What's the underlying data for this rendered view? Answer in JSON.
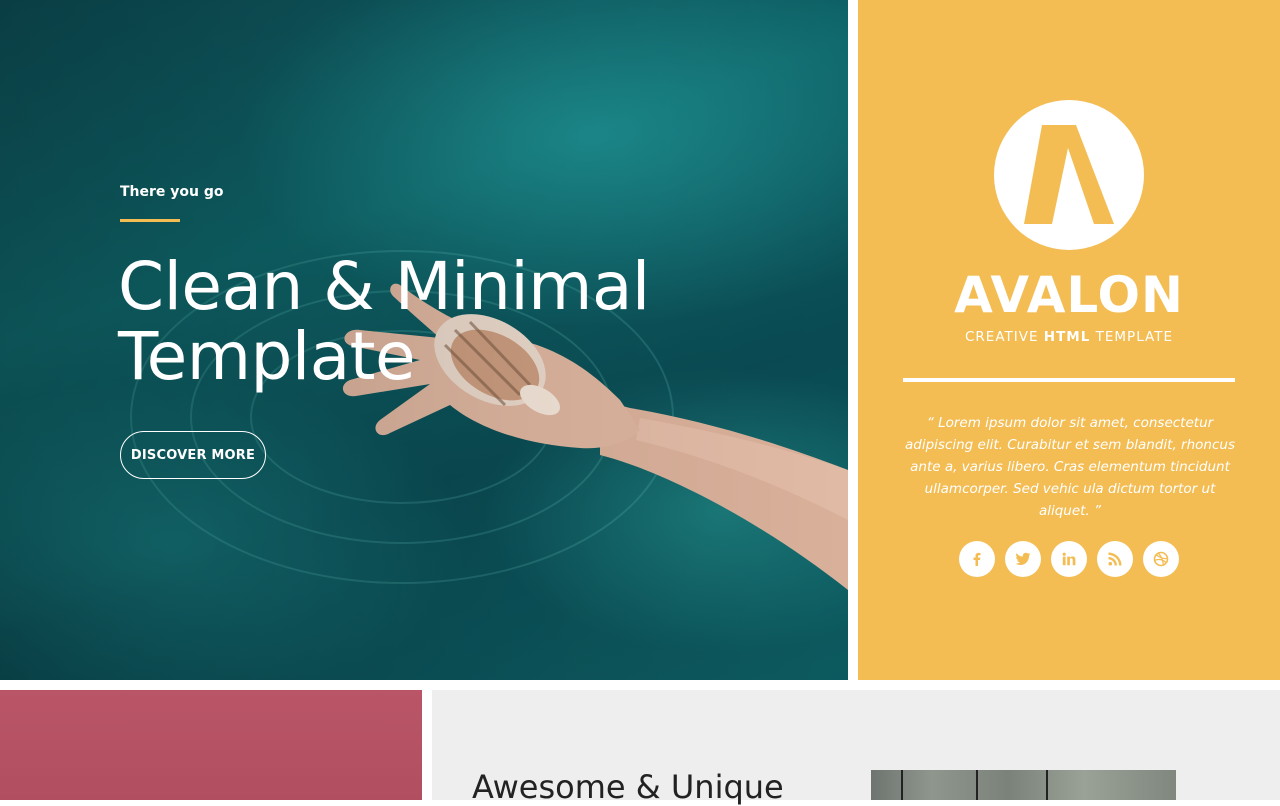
{
  "hero": {
    "eyebrow": "There you go",
    "title_line1": "Clean & Minimal",
    "title_line2": "Template",
    "button_label": "DISCOVER MORE"
  },
  "brand": {
    "name": "AVALON",
    "tagline_pre": "CREATIVE ",
    "tagline_bold": "HTML",
    "tagline_post": " TEMPLATE",
    "quote": "“ Lorem ipsum dolor sit amet, consectetur adipiscing elit. Curabitur et sem blandit, rhoncus ante a, varius libero. Cras elementum tincidunt ullamcorper. Sed vehic ula dictum tortor ut aliquet. ”",
    "socials": [
      {
        "icon": "facebook-icon"
      },
      {
        "icon": "twitter-icon"
      },
      {
        "icon": "linkedin-icon"
      },
      {
        "icon": "rss-icon"
      },
      {
        "icon": "dribbble-icon"
      }
    ]
  },
  "features": {
    "title": "Awesome & Unique"
  },
  "colors": {
    "accent": "#f3bd54",
    "pink": "#b5536a",
    "gray": "#eeeeee",
    "water": "#0e6468"
  }
}
